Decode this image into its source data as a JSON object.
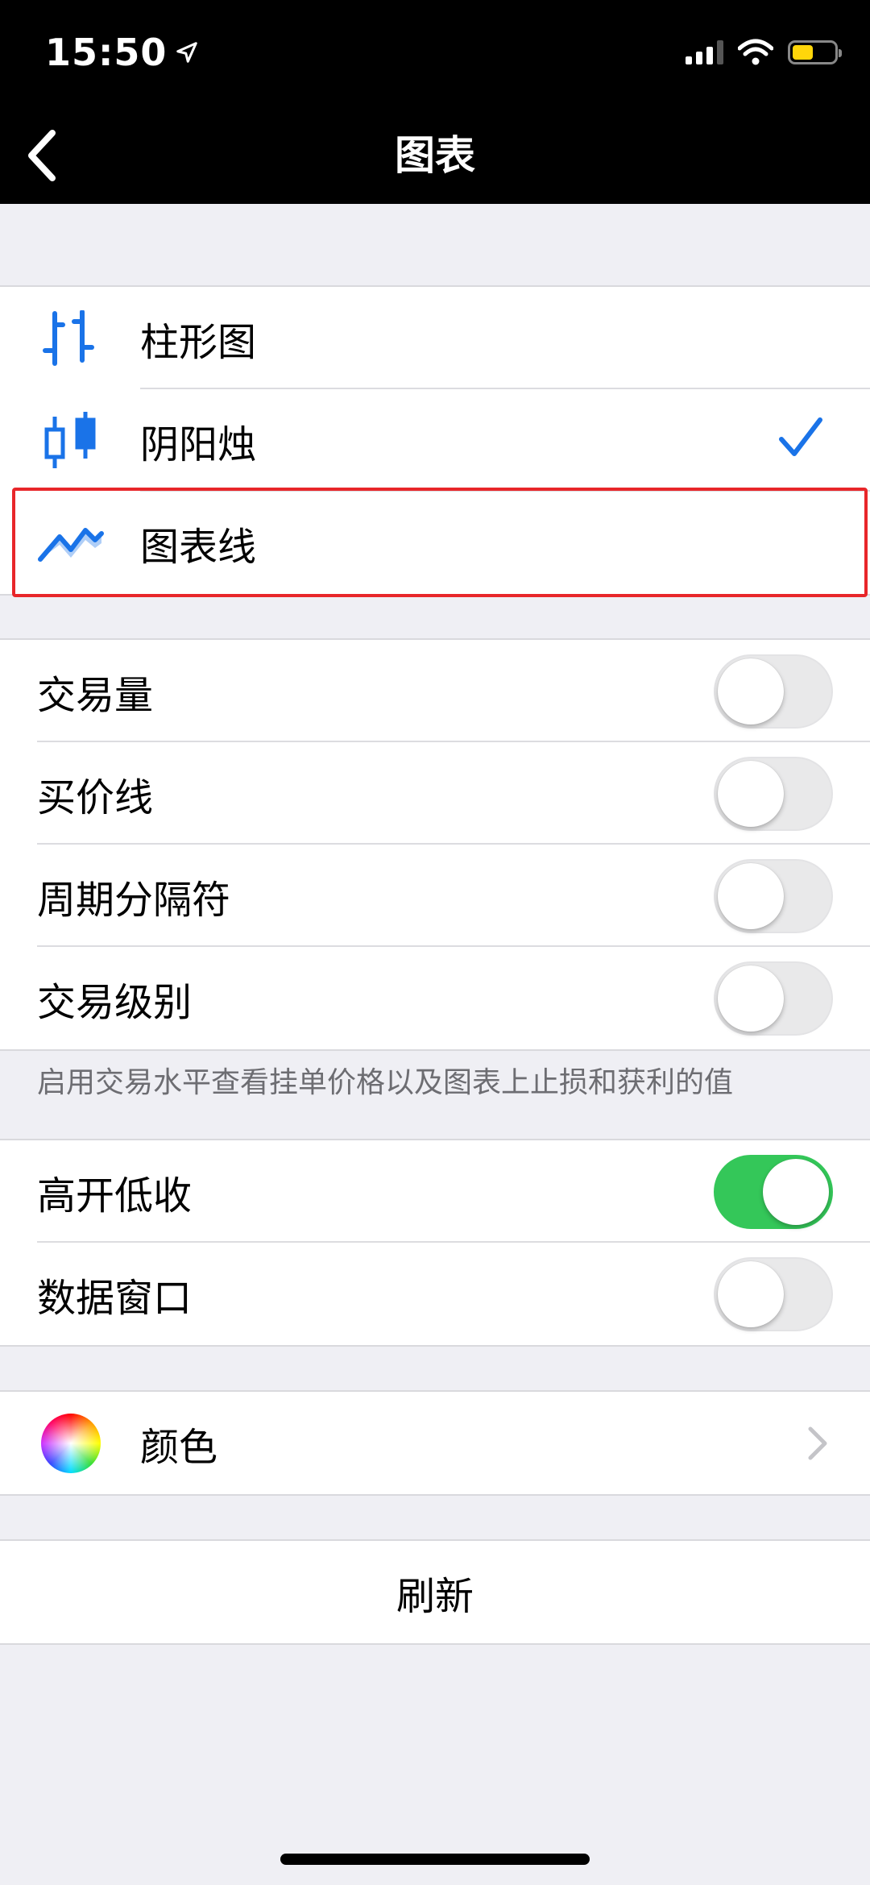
{
  "status_bar": {
    "time": "15:50"
  },
  "nav": {
    "title": "图表"
  },
  "chart_types": [
    {
      "label": "柱形图",
      "icon": "bar-chart-icon",
      "checked": false
    },
    {
      "label": "阴阳烛",
      "icon": "candlestick-icon",
      "checked": true
    },
    {
      "label": "图表线",
      "icon": "line-chart-icon",
      "checked": false
    }
  ],
  "toggles_a": [
    {
      "label": "交易量",
      "on": false
    },
    {
      "label": "买价线",
      "on": false
    },
    {
      "label": "周期分隔符",
      "on": false
    },
    {
      "label": "交易级别",
      "on": false
    }
  ],
  "footnote": "启用交易水平查看挂单价格以及图表上止损和获利的值",
  "toggles_b": [
    {
      "label": "高开低收",
      "on": true
    },
    {
      "label": "数据窗口",
      "on": false
    }
  ],
  "colors": {
    "label": "颜色"
  },
  "refresh": {
    "label": "刷新"
  },
  "theme": {
    "accent": "#1a73e8",
    "toggle_on": "#34c759",
    "highlight": "#e8262a"
  }
}
